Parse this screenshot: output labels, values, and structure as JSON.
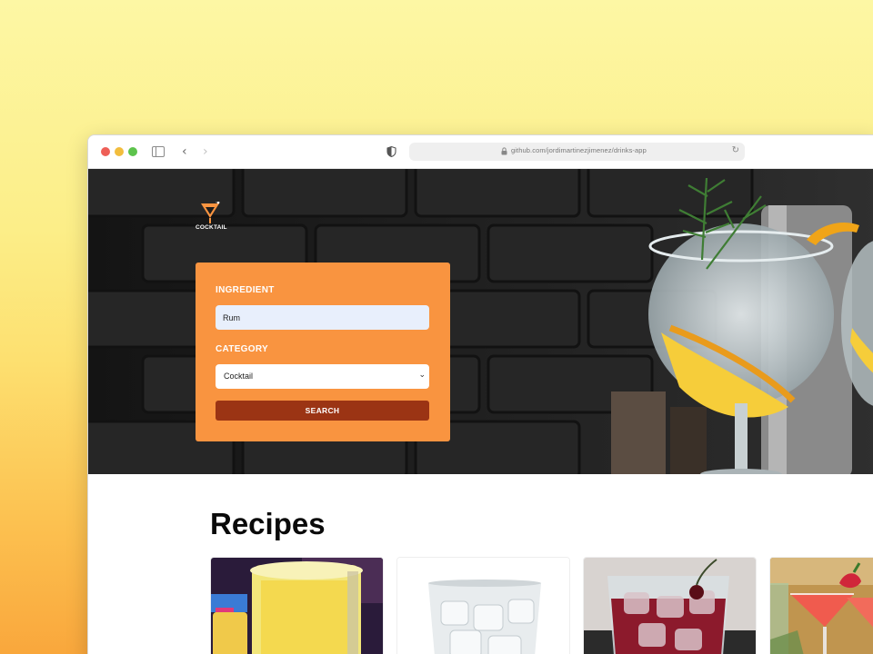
{
  "browser": {
    "url": "github.com/jordimartinezjimenez/drinks-app"
  },
  "brand": {
    "logo_text": "COCKTAIL",
    "accent": "#f99440",
    "button_color": "#9b3414"
  },
  "search_form": {
    "ingredient_label": "INGREDIENT",
    "ingredient_value": "Rum",
    "category_label": "CATEGORY",
    "category_value": "Cocktail",
    "search_button": "SEARCH"
  },
  "recipes": {
    "title": "Recipes",
    "cards": [
      {
        "image": "yellow-cocktail-bar"
      },
      {
        "image": "clear-glass-ice"
      },
      {
        "image": "red-drink-cherry"
      },
      {
        "image": "pink-martini-strawberry"
      }
    ]
  }
}
